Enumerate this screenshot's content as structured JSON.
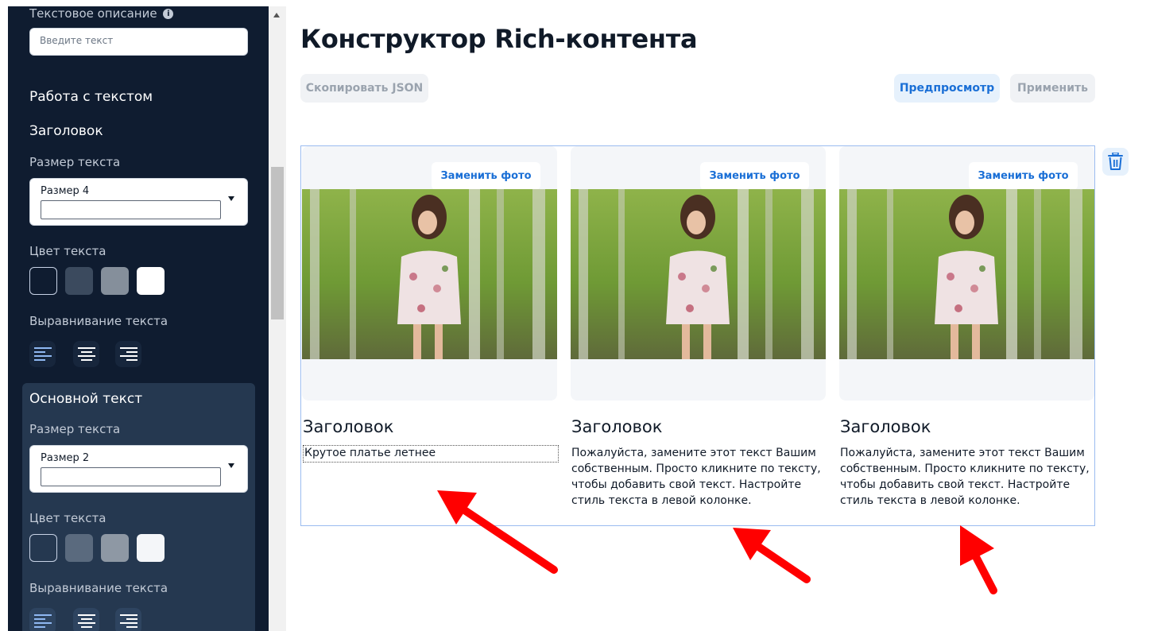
{
  "sidebar": {
    "text_description_label": "Текстовое описание",
    "text_input_placeholder": "Введите текст",
    "work_with_text": "Работа с текстом",
    "heading_section": {
      "title": "Заголовок",
      "size_label": "Размер текста",
      "size_value": "Размер 4",
      "color_label": "Цвет текста",
      "colors": [
        "#0f1c30",
        "#3b4a5e",
        "#858f9b",
        "#ffffff"
      ],
      "align_label": "Выравнивание текста"
    },
    "body_section": {
      "title": "Основной текст",
      "size_label": "Размер текста",
      "size_value": "Размер 2",
      "color_label": "Цвет текста",
      "colors": [
        "#253850",
        "#5a6a7e",
        "#8e98a4",
        "#f4f6f9"
      ],
      "align_label": "Выравнивание текста"
    }
  },
  "main": {
    "title": "Конструктор Rich-контента",
    "copy_json_label": "Скопировать JSON",
    "preview_label": "Предпросмотр",
    "apply_label": "Применить",
    "columns": [
      {
        "replace_photo": "Заменить фото",
        "heading": "Заголовок",
        "body": "Крутое платье летнее"
      },
      {
        "replace_photo": "Заменить фото",
        "heading": "Заголовок",
        "body": "Пожалуйста, замените этот текст Вашим собственным. Просто кликните по тексту, чтобы добавить свой текст. Настройте стиль текста в левой колонке."
      },
      {
        "replace_photo": "Заменить фото",
        "heading": "Заголовок",
        "body": "Пожалуйста, замените этот текст Вашим собственным. Просто кликните по тексту, чтобы добавить свой текст. Настройте стиль текста в левой колонке."
      }
    ]
  },
  "icons": {
    "info": "info-icon",
    "dropdown": "chevron-down-icon",
    "align_left": "align-left-icon",
    "align_center": "align-center-icon",
    "align_right": "align-right-icon",
    "delete": "trash-icon",
    "annotation": "red-arrow"
  },
  "colors": {
    "sidebar_bg": "#0f1c30",
    "accent_blue": "#1a6fd6",
    "annotation_red": "#ff0000"
  }
}
